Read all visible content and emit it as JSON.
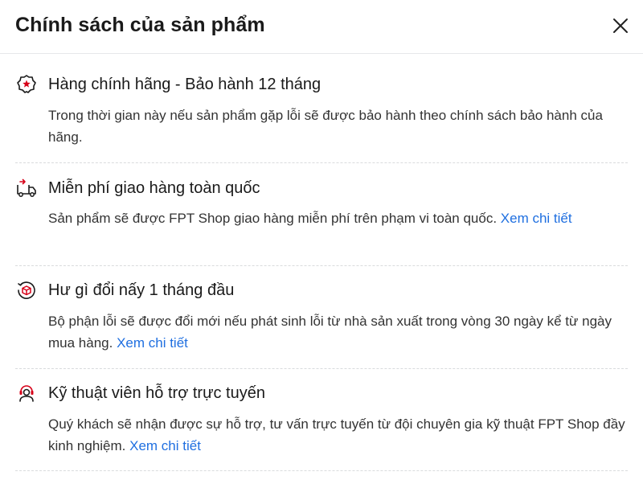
{
  "header": {
    "title": "Chính sách của sản phẩm",
    "close_icon": "close-icon"
  },
  "policies": [
    {
      "icon": "certified-ribbon-icon",
      "title": "Hàng chính hãng - Bảo hành 12 tháng",
      "description": "Trong thời gian này nếu sản phẩm gặp lỗi sẽ được bảo hành theo chính sách bảo hành của hãng.",
      "link": ""
    },
    {
      "icon": "delivery-truck-icon",
      "title": "Miễn phí giao hàng toàn quốc",
      "description": "Sản phẩm sẽ được FPT Shop giao hàng miễn phí trên phạm vi toàn quốc. ",
      "link": "Xem chi tiết"
    },
    {
      "icon": "exchange-box-icon",
      "title": "Hư gì đổi nấy 1 tháng đầu",
      "description": "Bộ phận lỗi sẽ được đổi mới nếu phát sinh lỗi từ nhà sản xuất trong vòng 30 ngày kể từ ngày mua hàng. ",
      "link": "Xem chi tiết"
    },
    {
      "icon": "support-headset-icon",
      "title": "Kỹ thuật viên hỗ trợ trực tuyến",
      "description": "Quý khách sẽ nhận được sự hỗ trợ, tư vấn trực tuyến từ đội chuyên gia kỹ thuật FPT Shop đầy kinh nghiệm. ",
      "link": "Xem chi tiết"
    }
  ],
  "colors": {
    "accent_red": "#d70018",
    "link_blue": "#1f6fe0",
    "text": "#1a1a1a"
  }
}
